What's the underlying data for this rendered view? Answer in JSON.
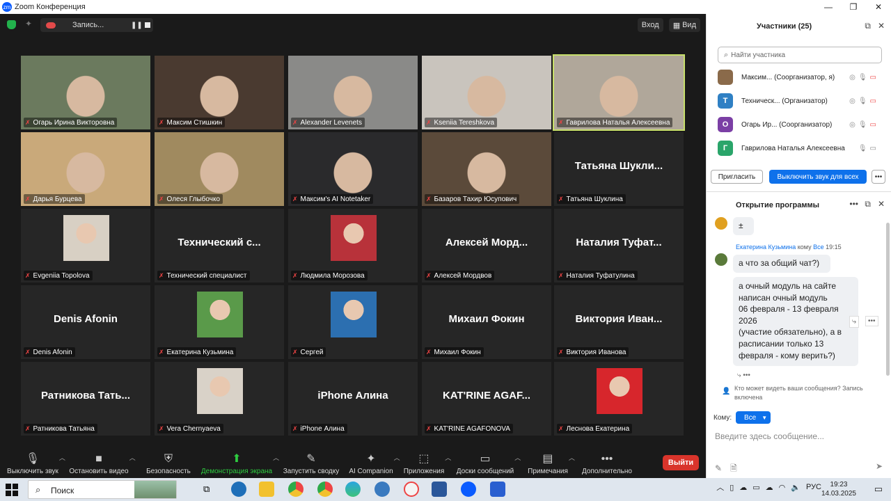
{
  "window": {
    "title": "Zoom Конференция",
    "controls": [
      "—",
      "❐",
      "✕"
    ]
  },
  "topbar": {
    "recording_label": "Запись...",
    "view_in": "Вход",
    "view_label": "Вид"
  },
  "tiles": [
    {
      "name": "Огарь Ирина Викторовна",
      "type": "video",
      "bg": "#6b7a5e"
    },
    {
      "name": "Максим Стишкин",
      "type": "video",
      "bg": "#4a3a30"
    },
    {
      "name": "Alexander Levenets",
      "type": "video",
      "bg": "#8a8a88"
    },
    {
      "name": "Kseniia Tereshkova",
      "type": "video",
      "bg": "#c9c4bd"
    },
    {
      "name": "Гаврилова Наталья Алексеевна",
      "type": "video",
      "bg": "#b0a79a",
      "active": true
    },
    {
      "name": "Дарья Бурцева",
      "type": "video",
      "bg": "#c9a97a"
    },
    {
      "name": "Олеся Глыбочко",
      "type": "video",
      "bg": "#a08a5f"
    },
    {
      "name": "Максим's AI Notetaker",
      "type": "video",
      "bg": "#2a2a2c"
    },
    {
      "name": "Базаров Тахир Юсупович",
      "type": "video",
      "bg": "#5b4a3a"
    },
    {
      "name": "Татьяна Шуклина",
      "type": "name",
      "big": "Татьяна Шукли..."
    },
    {
      "name": "Evgeniia Topolova",
      "type": "avatar",
      "avatar_color": "#d8d0c4"
    },
    {
      "name": "Технический специалист",
      "type": "name",
      "big": "Технический с..."
    },
    {
      "name": "Людмила Морозова",
      "type": "avatar",
      "avatar_color": "#b8323a"
    },
    {
      "name": "Алексей Мордвов",
      "type": "name",
      "big": "Алексей Морд..."
    },
    {
      "name": "Наталия Туфатулина",
      "type": "name",
      "big": "Наталия Туфат..."
    },
    {
      "name": "Denis Afonin",
      "type": "name",
      "big": "Denis Afonin"
    },
    {
      "name": "Екатерина Кузьмина",
      "type": "avatar",
      "avatar_color": "#5a9a4a"
    },
    {
      "name": "Сергей",
      "type": "avatar",
      "avatar_color": "#2c6fb0"
    },
    {
      "name": "Михаил Фокин",
      "type": "name",
      "big": "Михаил Фокин"
    },
    {
      "name": "Виктория Иванова",
      "type": "name",
      "big": "Виктория Иван..."
    },
    {
      "name": "Ратникова Татьяна",
      "type": "name",
      "big": "Ратникова Тать..."
    },
    {
      "name": "Vera Chernyaeva",
      "type": "avatar",
      "avatar_color": "#d9d2c8"
    },
    {
      "name": "iPhone Алина",
      "type": "name",
      "big": "iPhone Алина"
    },
    {
      "name": "KAT'RINE AGAFONOVA",
      "type": "name",
      "big": "KAT'RINE AGAF..."
    },
    {
      "name": "Леснова Екатерина",
      "type": "avatar",
      "avatar_color": "#d7262c"
    }
  ],
  "toolbar": {
    "items": [
      {
        "label": "Выключить звук",
        "icon": "🎙",
        "caret": true
      },
      {
        "label": "Остановить видео",
        "icon": "■",
        "caret": true
      },
      {
        "label": "Безопасность",
        "icon": "⛨",
        "caret": false
      },
      {
        "label": "Демонстрация экрана",
        "icon": "⬆",
        "caret": true,
        "green": true
      },
      {
        "label": "Запустить сводку",
        "icon": "✎",
        "caret": false
      },
      {
        "label": "AI Companion",
        "icon": "✦",
        "caret": true
      },
      {
        "label": "Приложения",
        "icon": "⬚",
        "caret": true
      },
      {
        "label": "Доски сообщений",
        "icon": "▭",
        "caret": true
      },
      {
        "label": "Примечания",
        "icon": "▤",
        "caret": true
      },
      {
        "label": "Дополнительно",
        "icon": "•••",
        "caret": false
      }
    ],
    "leave": "Выйти"
  },
  "participants": {
    "title": "Участники (25)",
    "search_placeholder": "Найти участника",
    "rows": [
      {
        "initial": "",
        "name": "Максим... (Соорганизатор, я)",
        "color": "#8a6a4a"
      },
      {
        "initial": "Т",
        "name": "Техническ...  (Организатор)",
        "color": "#2f80c4"
      },
      {
        "initial": "О",
        "name": "Огарь Ир...  (Соорганизатор)",
        "color": "#7b3fa5"
      },
      {
        "initial": "Г",
        "name": "Гаврилова Наталья Алексеевна",
        "color": "#2aa56a"
      }
    ],
    "invite": "Пригласить",
    "mute_all": "Выключить звук для всех"
  },
  "chat": {
    "title": "Открытие программы",
    "prev_msg": "±",
    "sender_name": "Екатерина Кузьмина",
    "sender_to": "кому",
    "sender_target": "Все",
    "sender_time": "19:15",
    "msg1": "а что за общий чат?)",
    "msg2_lines": [
      "а очный модуль на сайте",
      "написан очный модуль",
      "06 февраля - 13 февраля",
      "2026",
      "(участие обязательно), а в",
      "расписании только 13",
      "февраля - кому верить?)"
    ],
    "notice": "Кто может видеть ваши сообщения? Запись включена",
    "to_label": "Кому:",
    "to_value": "Все",
    "input_placeholder": "Введите здесь сообщение..."
  },
  "taskbar": {
    "search": "Поиск",
    "lang": "РУС",
    "time": "19:23",
    "date": "14.03.2025"
  }
}
